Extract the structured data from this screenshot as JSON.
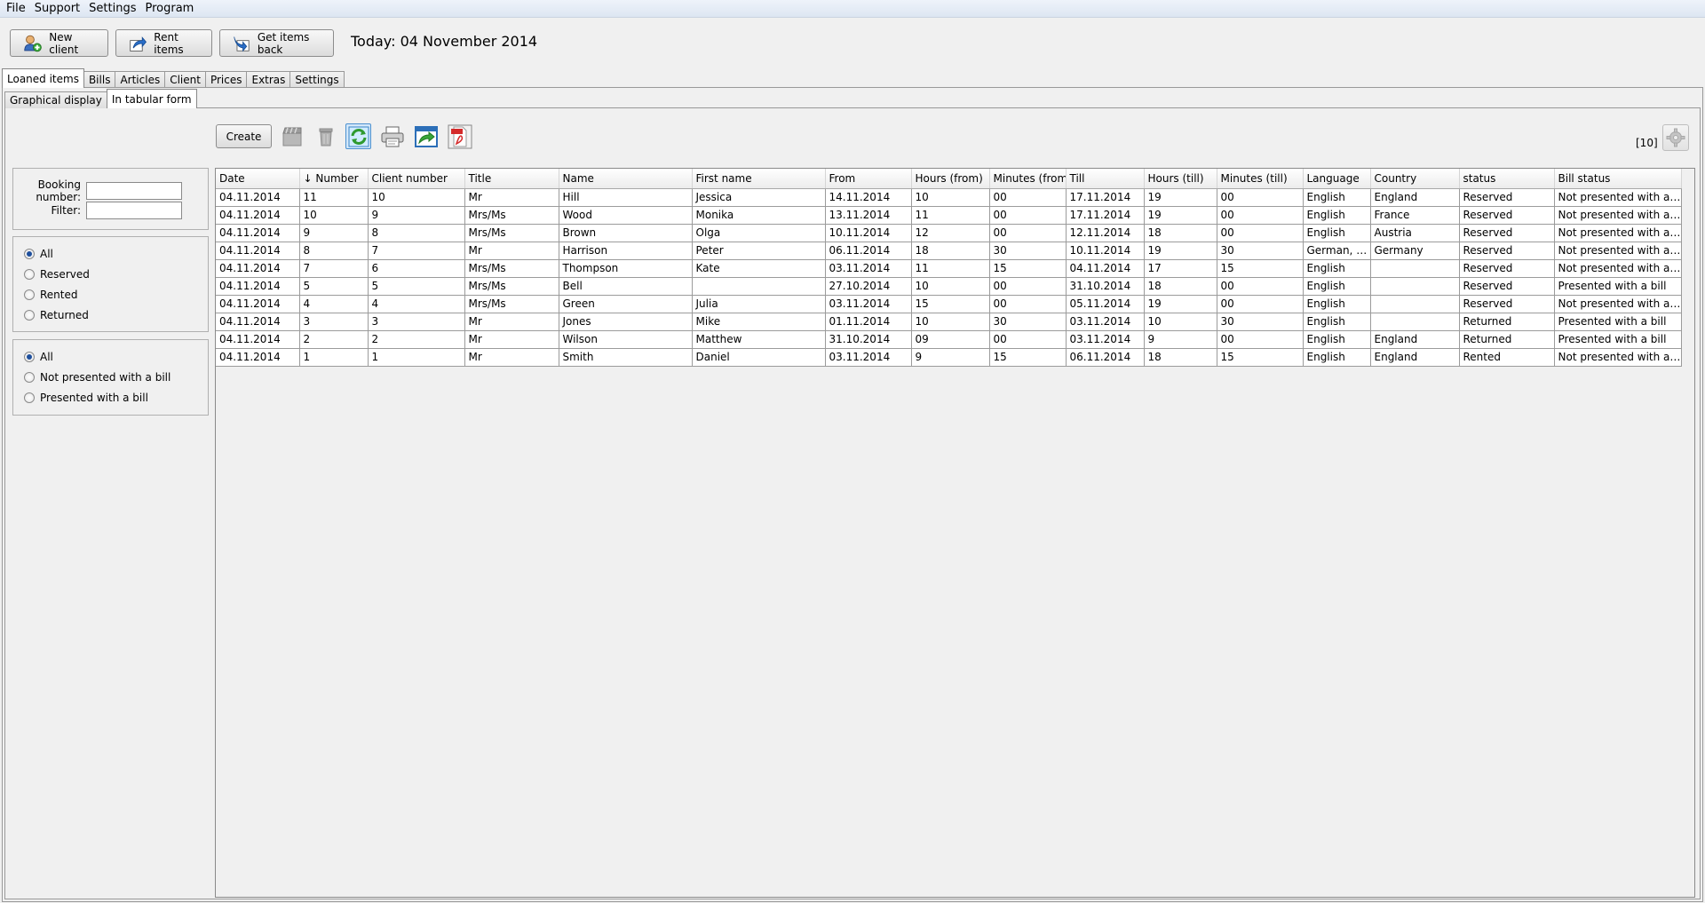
{
  "menu": [
    "File",
    "Support",
    "Settings",
    "Program"
  ],
  "toolbar": {
    "new_client": "New client",
    "rent_items": "Rent items",
    "get_items_back": "Get items back",
    "today": "Today: 04 November 2014"
  },
  "main_tabs": [
    "Loaned items",
    "Bills",
    "Articles",
    "Client",
    "Prices",
    "Extras",
    "Settings"
  ],
  "sub_tabs": [
    "Graphical display",
    "In tabular form"
  ],
  "filters": {
    "booking_label": "Booking number:",
    "booking_value": "",
    "filter_label": "Filter:",
    "filter_value": ""
  },
  "status_radios": [
    "All",
    "Reserved",
    "Rented",
    "Returned"
  ],
  "bill_radios": [
    "All",
    "Not presented with a bill",
    "Presented with a bill"
  ],
  "actions": {
    "create": "Create",
    "count": "[10]"
  },
  "table": {
    "columns": [
      "Date",
      "↓ Number",
      "Client number",
      "Title",
      "Name",
      "First name",
      "From",
      "Hours (from)",
      "Minutes (from)",
      "Till",
      "Hours (till)",
      "Minutes (till)",
      "Language",
      "Country",
      "status",
      "Bill status"
    ],
    "rows": [
      [
        "04.11.2014",
        "11",
        "10",
        "Mr",
        "Hill",
        "Jessica",
        "14.11.2014",
        "10",
        "00",
        "17.11.2014",
        "19",
        "00",
        "English",
        "England",
        "Reserved",
        "Not presented with a bill"
      ],
      [
        "04.11.2014",
        "10",
        "9",
        "Mrs/Ms",
        "Wood",
        "Monika",
        "13.11.2014",
        "11",
        "00",
        "17.11.2014",
        "19",
        "00",
        "English",
        "France",
        "Reserved",
        "Not presented with a bill"
      ],
      [
        "04.11.2014",
        "9",
        "8",
        "Mrs/Ms",
        "Brown",
        "Olga",
        "10.11.2014",
        "12",
        "00",
        "12.11.2014",
        "18",
        "00",
        "English",
        "Austria",
        "Reserved",
        "Not presented with a bill"
      ],
      [
        "04.11.2014",
        "8",
        "7",
        "Mr",
        "Harrison",
        "Peter",
        "06.11.2014",
        "18",
        "30",
        "10.11.2014",
        "19",
        "30",
        "German, en...",
        "Germany",
        "Reserved",
        "Not presented with a bill"
      ],
      [
        "04.11.2014",
        "7",
        "6",
        "Mrs/Ms",
        "Thompson",
        "Kate",
        "03.11.2014",
        "11",
        "15",
        "04.11.2014",
        "17",
        "15",
        "English",
        "",
        "Reserved",
        "Not presented with a bill"
      ],
      [
        "04.11.2014",
        "5",
        "5",
        "Mrs/Ms",
        "Bell",
        "",
        "27.10.2014",
        "10",
        "00",
        "31.10.2014",
        "18",
        "00",
        "English",
        "",
        "Reserved",
        "Presented with a bill"
      ],
      [
        "04.11.2014",
        "4",
        "4",
        "Mrs/Ms",
        "Green",
        "Julia",
        "03.11.2014",
        "15",
        "00",
        "05.11.2014",
        "19",
        "00",
        "English",
        "",
        "Reserved",
        "Not presented with a bill"
      ],
      [
        "04.11.2014",
        "3",
        "3",
        "Mr",
        "Jones",
        "Mike",
        "01.11.2014",
        "10",
        "30",
        "03.11.2014",
        "10",
        "30",
        "English",
        "",
        "Returned",
        "Presented with a bill"
      ],
      [
        "04.11.2014",
        "2",
        "2",
        "Mr",
        "Wilson",
        "Matthew",
        "31.10.2014",
        "09",
        "00",
        "03.11.2014",
        "9",
        "00",
        "English",
        "England",
        "Returned",
        "Presented with a bill"
      ],
      [
        "04.11.2014",
        "1",
        "1",
        "Mr",
        "Smith",
        "Daniel",
        "03.11.2014",
        "9",
        "15",
        "06.11.2014",
        "18",
        "15",
        "English",
        "England",
        "Rented",
        "Not presented with a bill"
      ]
    ]
  }
}
